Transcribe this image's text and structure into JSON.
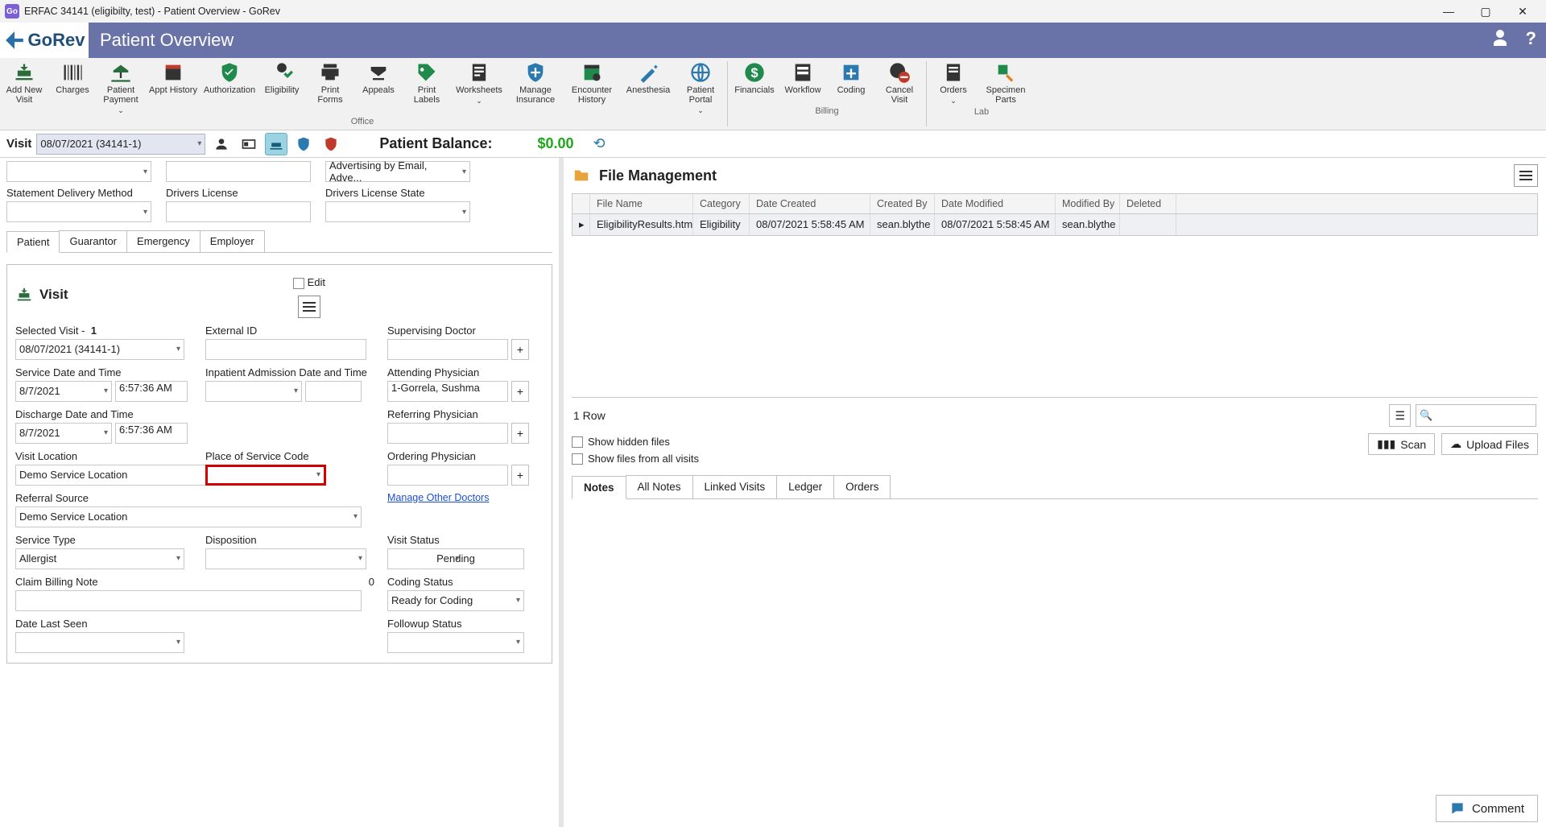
{
  "window": {
    "title": "ERFAC 34141 (eligibilty, test) - Patient Overview - GoRev",
    "app_short": "Go"
  },
  "banner": {
    "logo_text": "GoRev",
    "page_title": "Patient Overview"
  },
  "ribbon": {
    "groups": {
      "office": "Office",
      "billing": "Billing",
      "lab": "Lab"
    },
    "items": {
      "add_new_visit": "Add New Visit",
      "charges": "Charges",
      "patient_payment": "Patient Payment",
      "appt_history": "Appt History",
      "authorization": "Authorization",
      "eligibility": "Eligibility",
      "print_forms": "Print Forms",
      "appeals": "Appeals",
      "print_labels": "Print Labels",
      "worksheets": "Worksheets",
      "manage_insurance": "Manage Insurance",
      "encounter_history": "Encounter History",
      "anesthesia": "Anesthesia",
      "patient_portal": "Patient Portal",
      "financials": "Financials",
      "workflow": "Workflow",
      "coding": "Coding",
      "cancel_visit": "Cancel Visit",
      "orders": "Orders",
      "specimen_parts": "Specimen Parts"
    }
  },
  "visitbar": {
    "label": "Visit",
    "selected": "08/07/2021 (34141-1)",
    "balance_label": "Patient Balance:",
    "balance_value": "$0.00"
  },
  "patient_top": {
    "advertising": "Advertising by Email, Adve...",
    "statement_delivery_label": "Statement Delivery Method",
    "drivers_license_label": "Drivers License",
    "drivers_license_state_label": "Drivers License State"
  },
  "patient_tabs": {
    "patient": "Patient",
    "guarantor": "Guarantor",
    "emergency": "Emergency",
    "employer": "Employer"
  },
  "visit_panel": {
    "title": "Visit",
    "edit": "Edit",
    "selected_visit_label": "Selected Visit -",
    "selected_visit_num": "1",
    "selected_visit_value": "08/07/2021 (34141-1)",
    "external_id_label": "External ID",
    "supervising_doctor_label": "Supervising Doctor",
    "service_dt_label": "Service Date and Time",
    "service_date": "8/7/2021",
    "service_time": "6:57:36 AM",
    "inpatient_label": "Inpatient Admission Date and Time",
    "attending_label": "Attending Physician",
    "attending_value": "1-Gorrela, Sushma",
    "discharge_label": "Discharge Date and Time",
    "discharge_date": "8/7/2021",
    "discharge_time": "6:57:36 AM",
    "referring_label": "Referring Physician",
    "visit_location_label": "Visit Location",
    "visit_location_value": "Demo Service Location",
    "pos_label": "Place of Service Code",
    "ordering_label": "Ordering Physician",
    "referral_source_label": "Referral Source",
    "referral_source_value": "Demo Service Location",
    "manage_other": "Manage Other Doctors",
    "service_type_label": "Service Type",
    "service_type_value": "Allergist",
    "disposition_label": "Disposition",
    "visit_status_label": "Visit Status",
    "visit_status_value": "Pending",
    "claim_billing_label": "Claim Billing Note",
    "claim_billing_count": "0",
    "coding_status_label": "Coding Status",
    "coding_status_value": "Ready for Coding",
    "date_last_seen_label": "Date Last Seen",
    "followup_label": "Followup Status"
  },
  "file_management": {
    "title": "File Management",
    "columns": {
      "file_name": "File Name",
      "category": "Category",
      "date_created": "Date Created",
      "created_by": "Created By",
      "date_modified": "Date Modified",
      "modified_by": "Modified By",
      "deleted": "Deleted"
    },
    "row": {
      "file_name": "EligibilityResults.html",
      "category": "Eligibility",
      "date_created": "08/07/2021 5:58:45 AM",
      "created_by": "sean.blythe",
      "date_modified": "08/07/2021 5:58:45 AM",
      "modified_by": "sean.blythe"
    },
    "row_count": "1 Row",
    "show_hidden": "Show hidden files",
    "show_all_visits": "Show files from all visits",
    "scan": "Scan",
    "upload": "Upload Files"
  },
  "right_tabs": {
    "notes": "Notes",
    "all_notes": "All Notes",
    "linked_visits": "Linked Visits",
    "ledger": "Ledger",
    "orders": "Orders"
  },
  "comment_btn": "Comment"
}
